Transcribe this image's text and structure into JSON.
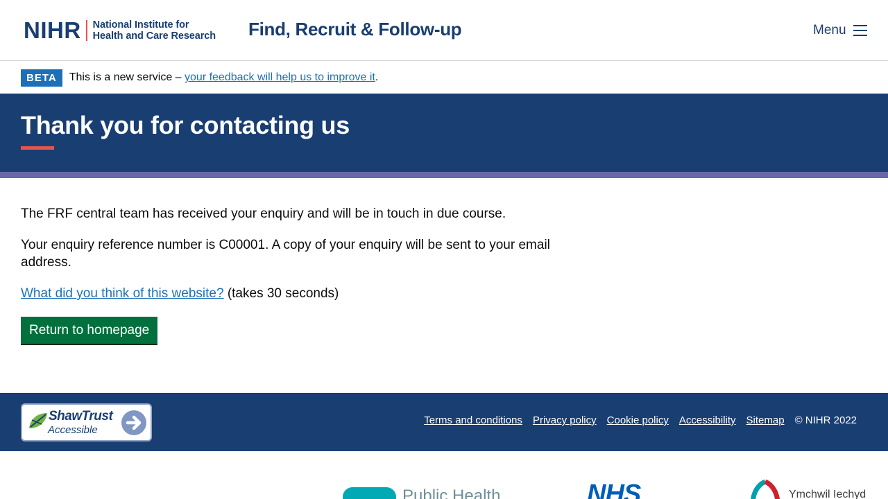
{
  "header": {
    "logo_brand": "NIHR",
    "logo_line1": "National Institute for",
    "logo_line2": "Health and Care Research",
    "service_title": "Find, Recruit & Follow-up",
    "menu_label": "Menu"
  },
  "beta": {
    "tag": "BETA",
    "text_before": "This is a new service – ",
    "link_text": "your feedback will help us to improve it",
    "text_after": "."
  },
  "hero": {
    "title": "Thank you for contacting us"
  },
  "main": {
    "para1": "The FRF central team has received your enquiry and will be in touch in due course.",
    "para2": "Your enquiry reference number is C00001. A copy of your enquiry will be sent to your email address.",
    "survey_link": "What did you think of this website?",
    "survey_suffix": " (takes 30 seconds)",
    "return_button": "Return to homepage"
  },
  "footer": {
    "shaw_title": "ShawTrust",
    "shaw_sub": "Accessible",
    "links": [
      "Terms and conditions",
      "Privacy policy",
      "Cookie policy",
      "Accessibility",
      "Sitemap"
    ],
    "copyright": "© NIHR 2022"
  },
  "partners": {
    "phe_text": "Public Health",
    "nhs_text": "NHS",
    "wales_text": "Ymchwil Iechyd"
  },
  "colors": {
    "brand_navy": "#193e72",
    "accent_coral": "#e5554f",
    "strip_purple": "#6a66aa",
    "link_blue": "#1d70b8",
    "button_green": "#00703c"
  }
}
